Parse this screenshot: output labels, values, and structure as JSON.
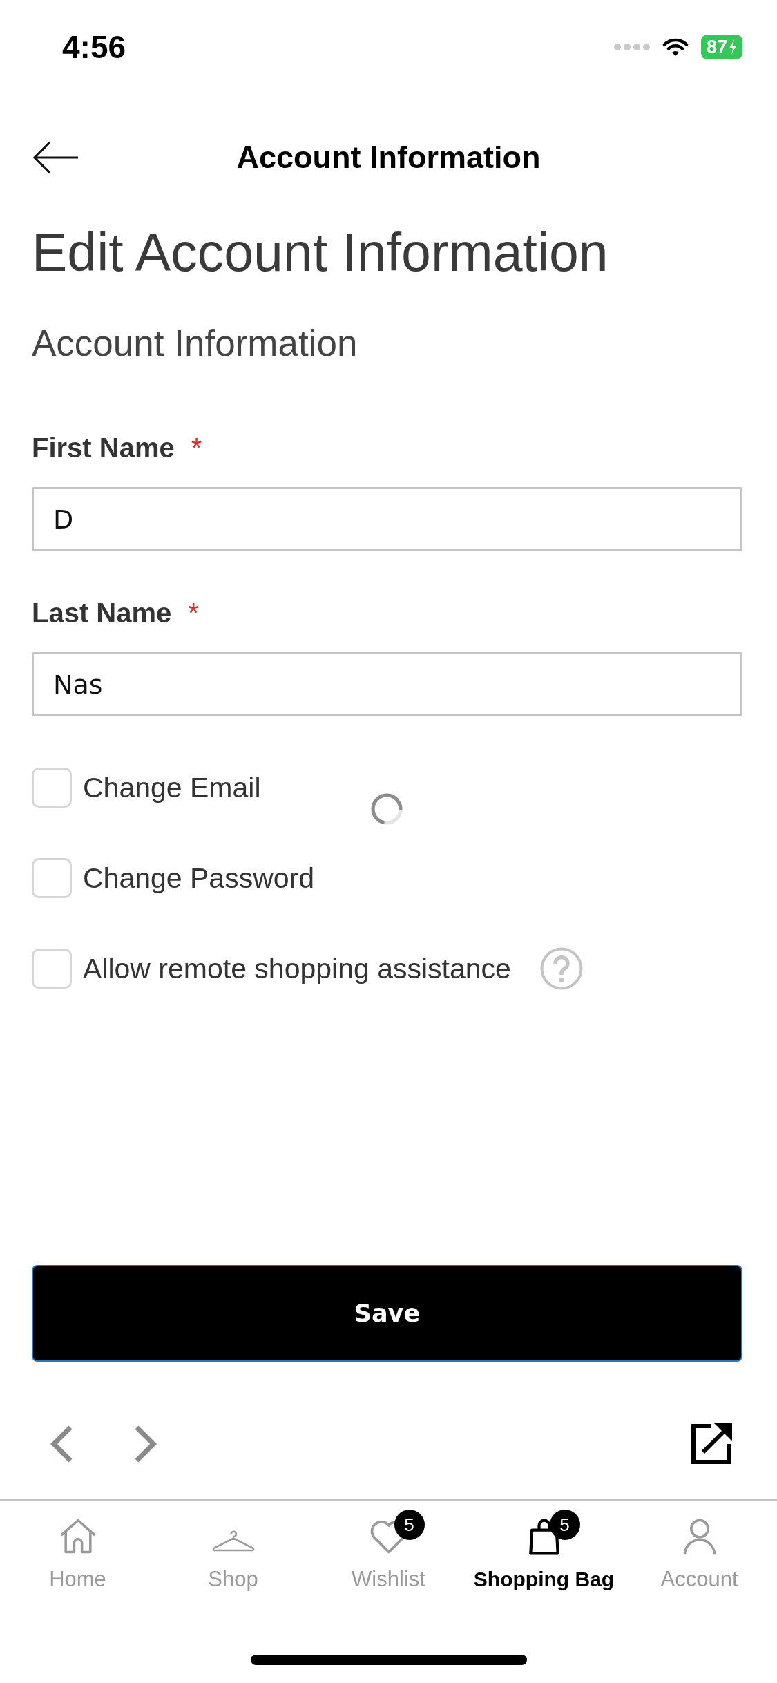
{
  "status_bar": {
    "time": "4:56",
    "battery_text": "87",
    "charging": true
  },
  "header": {
    "title": "Account Information"
  },
  "page": {
    "title": "Edit Account Information",
    "section_title": "Account Information"
  },
  "fields": [
    {
      "label": "First Name",
      "required_mark": "*",
      "value": "D"
    },
    {
      "label": "Last Name",
      "required_mark": "*",
      "value": "Nas"
    }
  ],
  "options": [
    {
      "label": "Change Email",
      "checked": false,
      "help": false
    },
    {
      "label": "Change Password",
      "checked": false,
      "help": false
    },
    {
      "label": "Allow remote shopping assistance",
      "checked": false,
      "help": true
    }
  ],
  "loading": true,
  "save_button": {
    "label": "Save"
  },
  "tabs": [
    {
      "kind": "home",
      "label": "Home",
      "selected": false
    },
    {
      "kind": "shop",
      "label": "Shop",
      "selected": false
    },
    {
      "kind": "wishlist",
      "label": "Wishlist",
      "selected": false,
      "badge": "5"
    },
    {
      "kind": "bag",
      "label": "Shopping Bag",
      "selected": true,
      "badge": "5"
    },
    {
      "kind": "account",
      "label": "Account",
      "selected": false
    }
  ]
}
